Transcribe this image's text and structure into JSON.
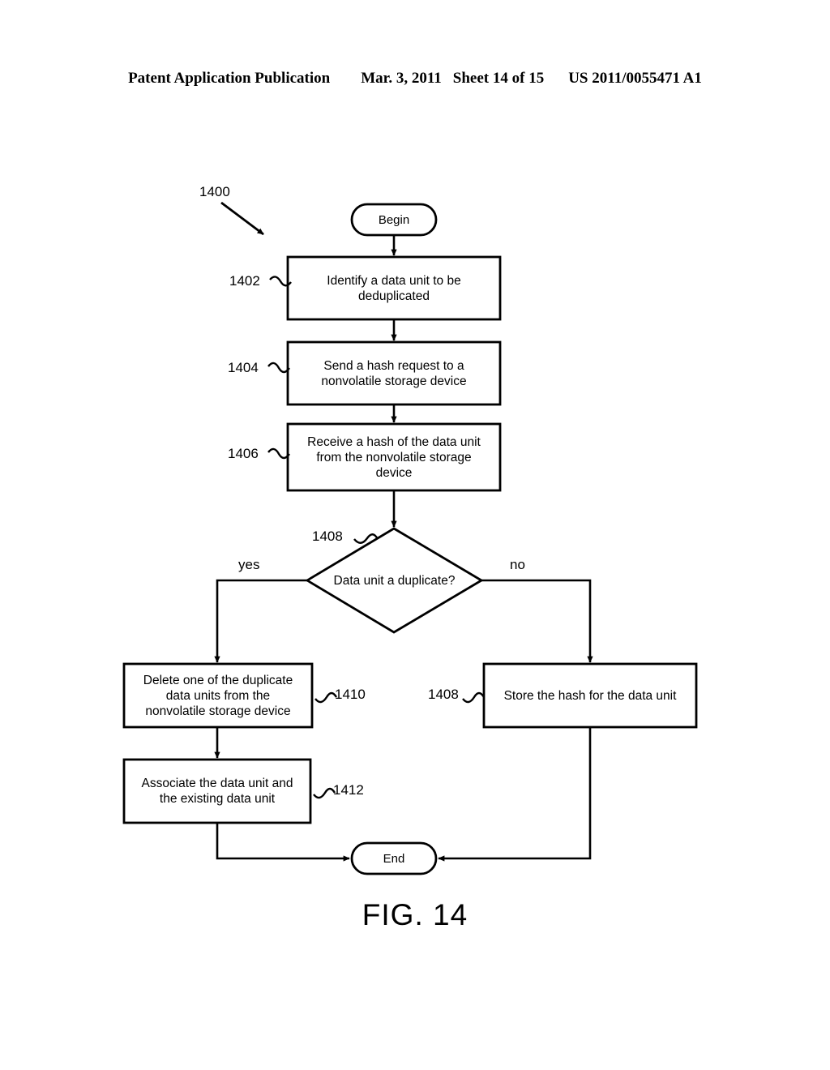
{
  "header": {
    "publication": "Patent Application Publication",
    "date": "Mar. 3, 2011",
    "sheet": "Sheet 14 of 15",
    "patent_number": "US 2011/0055471 A1"
  },
  "figure": {
    "caption": "FIG. 14",
    "diagram_ref": "1400",
    "colors": {
      "ink": "#000000",
      "background": "#ffffff"
    },
    "nodes": [
      {
        "id": "begin",
        "ref": "",
        "shape": "terminator",
        "text": "Begin"
      },
      {
        "id": "n1402",
        "ref": "1402",
        "shape": "process",
        "text": "Identify a data unit to be\ndeduplicated"
      },
      {
        "id": "n1404",
        "ref": "1404",
        "shape": "process",
        "text": "Send a hash request to a\nnonvolatile storage device"
      },
      {
        "id": "n1406",
        "ref": "1406",
        "shape": "process",
        "text": "Receive a hash of the data unit\nfrom the nonvolatile storage\ndevice"
      },
      {
        "id": "n1408",
        "ref": "1408",
        "shape": "decision",
        "text": "Data unit a duplicate?"
      },
      {
        "id": "n1410",
        "ref": "1410",
        "shape": "process",
        "text": "Delete one of the duplicate\ndata units from the\nnonvolatile storage device"
      },
      {
        "id": "n1412",
        "ref": "1412",
        "shape": "process",
        "text": "Associate the data unit and\nthe existing data unit"
      },
      {
        "id": "n1408b",
        "ref": "1408",
        "shape": "process",
        "text": "Store the hash for the data unit"
      },
      {
        "id": "end",
        "ref": "",
        "shape": "terminator",
        "text": "End"
      }
    ],
    "branch_labels": {
      "yes": "yes",
      "no": "no"
    }
  }
}
